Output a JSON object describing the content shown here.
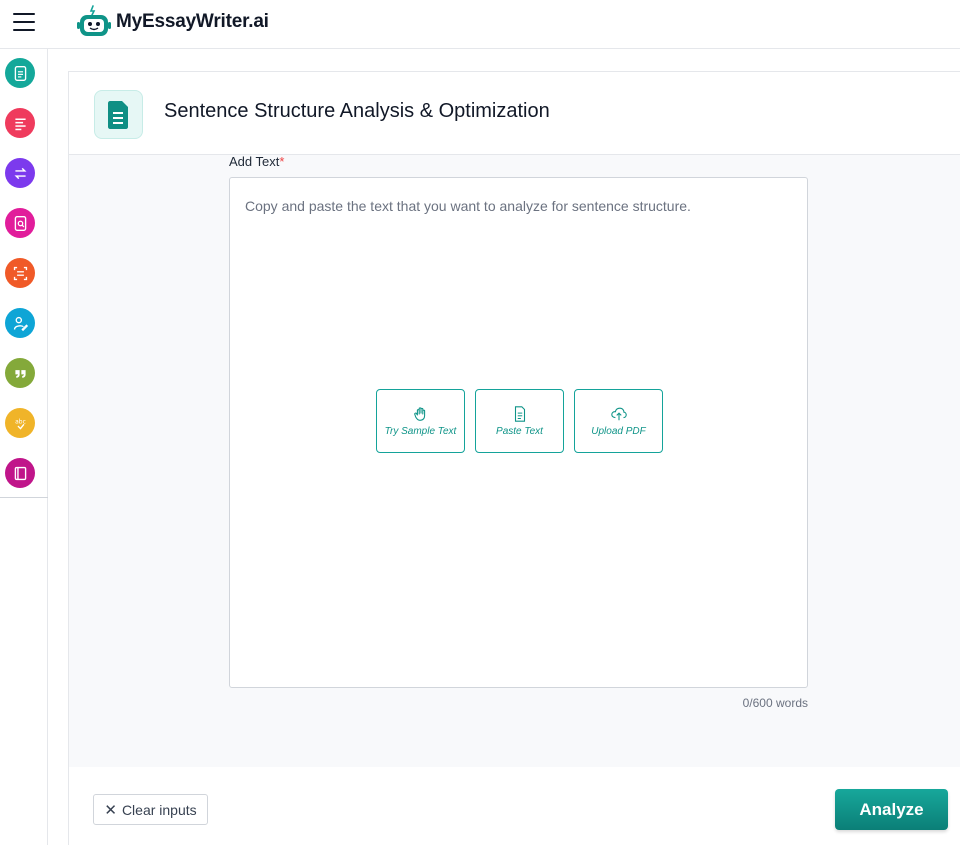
{
  "app": {
    "brand": "MyEssayWriter.ai"
  },
  "sidebar": {
    "items": [
      {
        "name": "document-tool",
        "color": "#14a89a"
      },
      {
        "name": "text-lines-tool",
        "color": "#ef3b5d"
      },
      {
        "name": "paraphrase-tool",
        "color": "#7c3aed"
      },
      {
        "name": "file-search-tool",
        "color": "#e11d9b"
      },
      {
        "name": "summarize-tool",
        "color": "#f05a28"
      },
      {
        "name": "user-edit-tool",
        "color": "#0ea5d6"
      },
      {
        "name": "quote-tool",
        "color": "#84a93a"
      },
      {
        "name": "spellcheck-tool",
        "color": "#f0b429"
      },
      {
        "name": "book-tool",
        "color": "#c0158a"
      }
    ]
  },
  "header": {
    "title": "Sentence Structure Analysis & Optimization",
    "icon": "document-icon"
  },
  "form": {
    "label": "Add Text",
    "required_mark": "*",
    "placeholder": "Copy and paste the text that you want to analyze for sentence structure.",
    "word_count": "0/600 words",
    "actions": {
      "sample": "Try Sample Text",
      "paste": "Paste Text",
      "upload": "Upload PDF"
    }
  },
  "footer": {
    "clear_label": "Clear inputs",
    "clear_icon": "✕",
    "analyze_label": "Analyze"
  },
  "colors": {
    "accent": "#14a39a",
    "required": "#ef4444"
  }
}
